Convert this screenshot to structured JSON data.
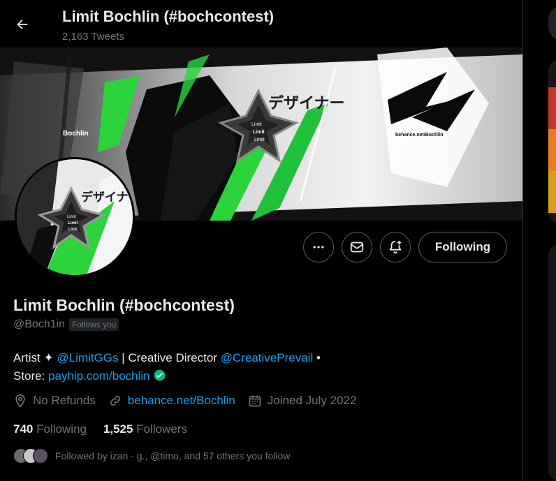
{
  "header": {
    "title": "Limit Bochlin (#bochcontest)",
    "tweets_count": "2,163 Tweets"
  },
  "banner": {
    "left_text": "Bochlin",
    "katakana": "デザイナー",
    "logo_lines": [
      "Limit",
      "Limit",
      "Limit"
    ],
    "url_text": "behance.net/Bochlin"
  },
  "avatar": {
    "katakana": "デザイナ",
    "logo_lines": [
      "Limit",
      "Limit",
      "Limit"
    ]
  },
  "actions": {
    "following_label": "Following"
  },
  "profile": {
    "name": "Limit Bochlin (#bochcontest)",
    "handle": "@Boch1in",
    "follows_you": "Follows you",
    "bio_artist": "Artist ✦",
    "bio_mention1": "@LimitGGs",
    "bio_mid": "| Creative Director",
    "bio_mention2": "@CreativePrevail",
    "bio_dot": "•",
    "bio_store": "Store:",
    "bio_store_link": "payhip.com/bochlin",
    "location": "No Refunds",
    "website": "behance.net/Bochlin",
    "joined": "Joined July 2022"
  },
  "stats": {
    "following_count": "740",
    "following_label": "Following",
    "followers_count": "1,525",
    "followers_label": "Followers"
  },
  "followed_by": {
    "text": "Followed by izan - g., @timo, and 57 others you follow"
  },
  "colors": {
    "accent": "#1d9bf0",
    "verified": "#00ba7c",
    "banner_green": "#2bd43b",
    "muted": "#71767b"
  }
}
